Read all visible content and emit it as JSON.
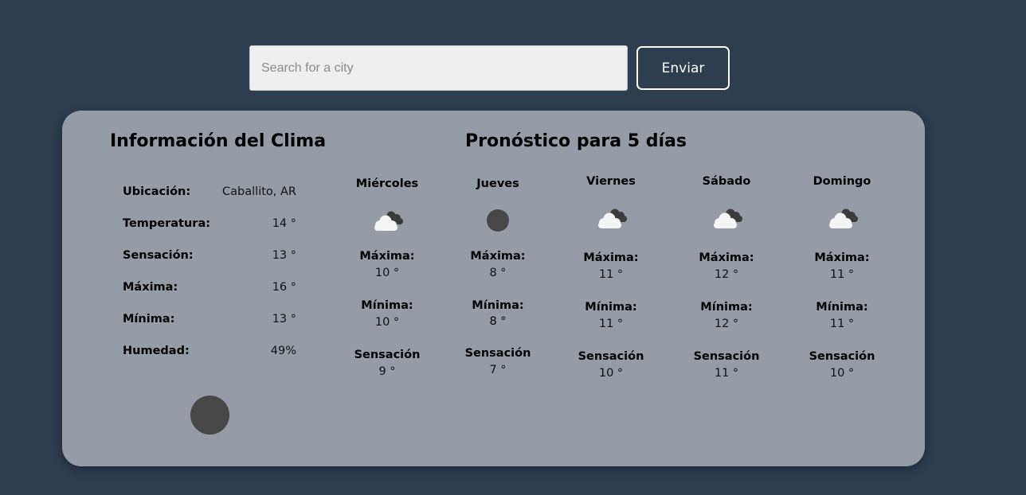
{
  "search": {
    "placeholder": "Search for a city",
    "value": "",
    "button_label": "Enviar"
  },
  "info": {
    "title": "Información del Clima",
    "rows": [
      {
        "label": "Ubicación:",
        "value": "Caballito, AR"
      },
      {
        "label": "Temperatura:",
        "value": "14 °"
      },
      {
        "label": "Sensación:",
        "value": "13 °"
      },
      {
        "label": "Máxima:",
        "value": "16 °"
      },
      {
        "label": "Mínima:",
        "value": "13 °"
      },
      {
        "label": "Humedad:",
        "value": "49%"
      }
    ],
    "icon": "moon-icon"
  },
  "forecast": {
    "title": "Pronóstico para 5 días",
    "labels": {
      "max": "Máxima:",
      "min": "Mínima:",
      "feels": "Sensación"
    },
    "days": [
      {
        "name": "Miércoles",
        "icon": "clouds-icon",
        "max": "10 °",
        "min": "10 °",
        "feels": "9 °"
      },
      {
        "name": "Jueves",
        "icon": "moon-icon",
        "max": "8 °",
        "min": "8 °",
        "feels": "7 °"
      },
      {
        "name": "Viernes",
        "icon": "clouds-icon",
        "max": "11 °",
        "min": "11 °",
        "feels": "10 °"
      },
      {
        "name": "Sábado",
        "icon": "clouds-icon",
        "max": "12 °",
        "min": "12 °",
        "feels": "11 °"
      },
      {
        "name": "Domingo",
        "icon": "clouds-icon",
        "max": "11 °",
        "min": "11 °",
        "feels": "10 °"
      }
    ]
  }
}
